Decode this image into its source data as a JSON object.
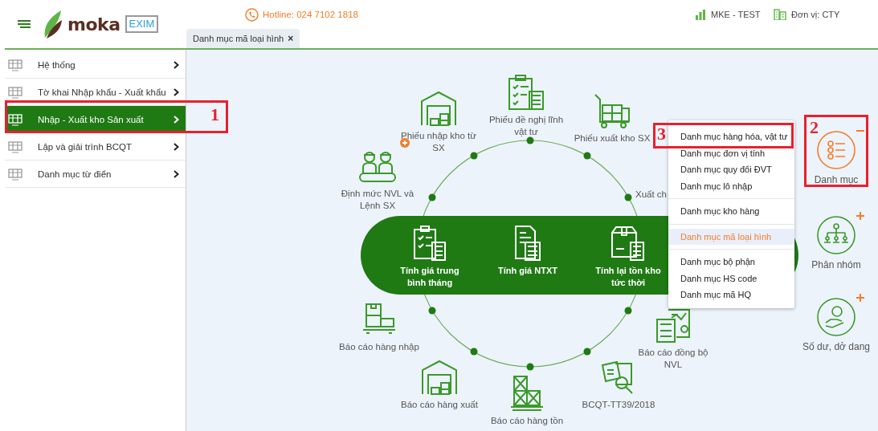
{
  "header": {
    "logo": {
      "name": "moka",
      "badge": "EXIM"
    },
    "hotline": "Hotline: 024 7102 1818",
    "company": "MKE - TEST",
    "unit": "Đơn vị: CTY"
  },
  "tabs": [
    {
      "label": "Danh mục mã loại hình",
      "close": "×",
      "selected": true
    }
  ],
  "sidebar": {
    "items": [
      {
        "label": "Hệ thống",
        "selected": false
      },
      {
        "label": "Tờ khai Nhập khẩu - Xuất khẩu",
        "selected": false
      },
      {
        "label": "Nhập - Xuất kho Sản xuất",
        "selected": true
      },
      {
        "label": "Lập và giải trình BCQT",
        "selected": false
      },
      {
        "label": "Danh mục từ điển",
        "selected": false
      }
    ]
  },
  "diagram": {
    "nodes": [
      {
        "label": "Phiếu nhập kho từ SX",
        "add_badge": true
      },
      {
        "label": "Phiếu đề nghị lĩnh vật tư",
        "add_badge": false
      },
      {
        "label": "Phiếu xuất kho SX",
        "add_badge": false
      },
      {
        "label": "Xuất ch",
        "add_badge": false
      },
      {
        "label": "Định mức NVL và Lệnh SX",
        "add_badge": false
      },
      {
        "label": "Báo cáo hàng nhập",
        "add_badge": false
      },
      {
        "label": "Báo cáo hàng xuất",
        "add_badge": false
      },
      {
        "label": "Báo cáo hàng tồn",
        "add_badge": false
      },
      {
        "label": "BCQT-TT39/2018",
        "add_badge": false
      },
      {
        "label": "Báo cáo đồng bộ NVL",
        "add_badge": false
      }
    ],
    "process_items": [
      {
        "label": "Tính giá trung bình tháng"
      },
      {
        "label": "Tính giá NTXT"
      },
      {
        "label": "Tính lại tồn kho tức thời"
      }
    ]
  },
  "side_actions": [
    {
      "label": "Danh mục",
      "expanded": true
    },
    {
      "label": "Phân nhóm",
      "expanded": false
    },
    {
      "label": "Số dư, dở dang",
      "expanded": false
    }
  ],
  "dropdown": {
    "groups": [
      [
        {
          "label": "Danh mục hàng hóa, vật tư",
          "selected": false
        },
        {
          "label": "Danh mục đơn vị tính",
          "selected": false
        },
        {
          "label": "Danh mục quy đổi ĐVT",
          "selected": false
        },
        {
          "label": "Danh mục lô nhập",
          "selected": false
        }
      ],
      [
        {
          "label": "Danh mục kho hàng",
          "selected": false
        }
      ],
      [
        {
          "label": "Danh mục mã loại hình",
          "selected": true
        }
      ],
      [
        {
          "label": "Danh mục bộ phận",
          "selected": false
        },
        {
          "label": "Danh mục HS code",
          "selected": false
        },
        {
          "label": "Danh mục mã HQ",
          "selected": false
        }
      ]
    ]
  },
  "annotations": [
    {
      "label": "1"
    },
    {
      "label": "2"
    },
    {
      "label": "3"
    }
  ]
}
